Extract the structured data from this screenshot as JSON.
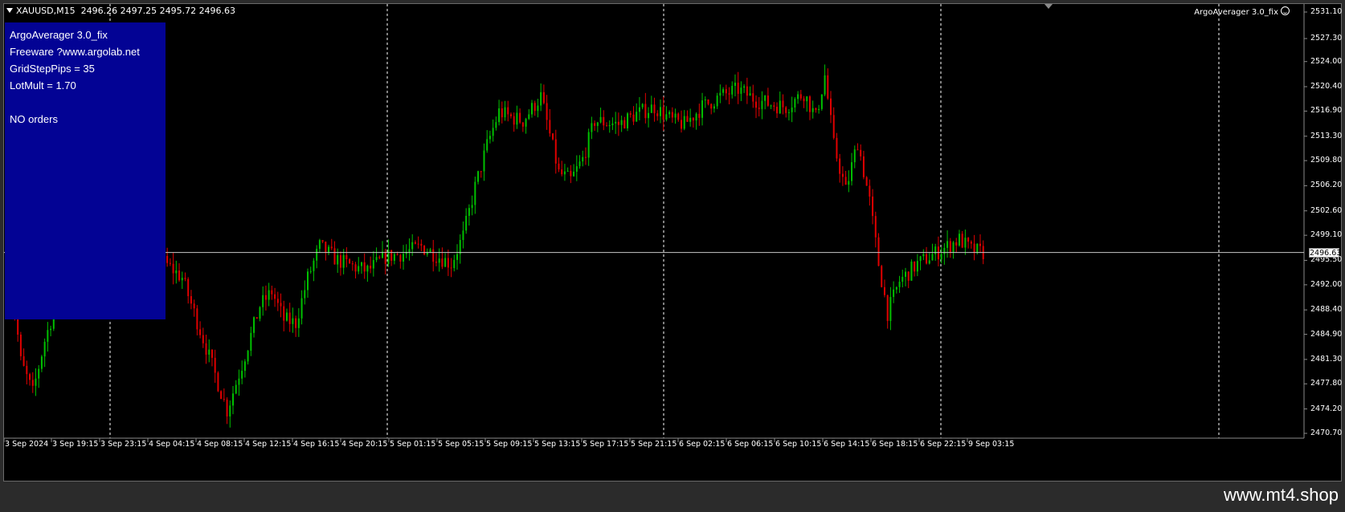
{
  "chart_header": {
    "symbol_timeframe": "XAUUSD,M15",
    "ohlc": "2496.26 2497.25 2495.72 2496.63"
  },
  "expert_advisor_label": "ArgoAverager 3.0_fix",
  "info_panel": {
    "lines": [
      "ArgoAverager 3.0_fix",
      "Freeware ?www.argolab.net",
      "GridStepPips = 35",
      "LotMult = 1.70",
      "",
      "NO orders"
    ],
    "background": "#030394"
  },
  "current_price": "2496.63",
  "price_axis_labels": [
    "2531.10",
    "2527.30",
    "2524.00",
    "2520.40",
    "2516.90",
    "2513.30",
    "2509.80",
    "2506.20",
    "2502.60",
    "2499.10",
    "2495.50",
    "2492.00",
    "2488.40",
    "2484.90",
    "2481.30",
    "2477.80",
    "2474.20",
    "2470.70"
  ],
  "time_axis_labels": [
    "3 Sep 2024",
    "3 Sep 19:15",
    "3 Sep 23:15",
    "4 Sep 04:15",
    "4 Sep 08:15",
    "4 Sep 12:15",
    "4 Sep 16:15",
    "4 Sep 20:15",
    "5 Sep 01:15",
    "5 Sep 05:15",
    "5 Sep 09:15",
    "5 Sep 13:15",
    "5 Sep 17:15",
    "5 Sep 21:15",
    "6 Sep 02:15",
    "6 Sep 06:15",
    "6 Sep 10:15",
    "6 Sep 14:15",
    "6 Sep 18:15",
    "6 Sep 22:15",
    "9 Sep 03:15"
  ],
  "colors": {
    "bull_candle": "#00c000",
    "bear_candle": "#e00000",
    "chart_background": "#000000",
    "grid_separator": "#ffffff"
  },
  "chart_data": {
    "type": "candlestick",
    "ylim": [
      2470.7,
      2531.1
    ],
    "close_path": [
      [
        0,
        2496.0
      ],
      [
        4,
        2481.0
      ],
      [
        8,
        2476.5
      ],
      [
        12,
        2484.0
      ],
      [
        16,
        2489.5
      ],
      [
        22,
        2490.0
      ],
      [
        26,
        2494.5
      ],
      [
        34,
        2495.5
      ],
      [
        38,
        2497.0
      ],
      [
        44,
        2496.0
      ],
      [
        52,
        2495.2
      ],
      [
        58,
        2493.0
      ],
      [
        66,
        2483.0
      ],
      [
        73,
        2474.0
      ],
      [
        78,
        2480.5
      ],
      [
        84,
        2489.0
      ],
      [
        88,
        2491.0
      ],
      [
        92,
        2487.0
      ],
      [
        96,
        2486.5
      ],
      [
        100,
        2493.0
      ],
      [
        104,
        2497.5
      ],
      [
        110,
        2495.5
      ],
      [
        116,
        2494.5
      ],
      [
        120,
        2494.0
      ],
      [
        126,
        2496.0
      ],
      [
        132,
        2496.5
      ],
      [
        138,
        2497.5
      ],
      [
        144,
        2496.0
      ],
      [
        148,
        2495.0
      ],
      [
        152,
        2499.0
      ],
      [
        156,
        2506.0
      ],
      [
        160,
        2512.0
      ],
      [
        164,
        2516.8
      ],
      [
        168,
        2516.0
      ],
      [
        172,
        2515.5
      ],
      [
        178,
        2519.0
      ],
      [
        184,
        2508.0
      ],
      [
        188,
        2507.0
      ],
      [
        192,
        2510.0
      ],
      [
        196,
        2515.5
      ],
      [
        204,
        2515.0
      ],
      [
        210,
        2516.5
      ],
      [
        216,
        2517.5
      ],
      [
        222,
        2515.5
      ],
      [
        226,
        2515.0
      ],
      [
        232,
        2517.5
      ],
      [
        238,
        2519.0
      ],
      [
        244,
        2520.0
      ],
      [
        250,
        2518.5
      ],
      [
        254,
        2518.0
      ],
      [
        260,
        2517.5
      ],
      [
        266,
        2519.5
      ],
      [
        270,
        2516.0
      ],
      [
        273,
        2522.0
      ],
      [
        276,
        2512.0
      ],
      [
        280,
        2505.5
      ],
      [
        284,
        2512.5
      ],
      [
        288,
        2504.0
      ],
      [
        291,
        2495.0
      ],
      [
        294,
        2488.0
      ],
      [
        298,
        2492.5
      ],
      [
        304,
        2495.0
      ],
      [
        310,
        2496.5
      ],
      [
        314,
        2497.5
      ],
      [
        318,
        2498.5
      ],
      [
        322,
        2497.0
      ],
      [
        326,
        2496.6
      ]
    ]
  }
}
